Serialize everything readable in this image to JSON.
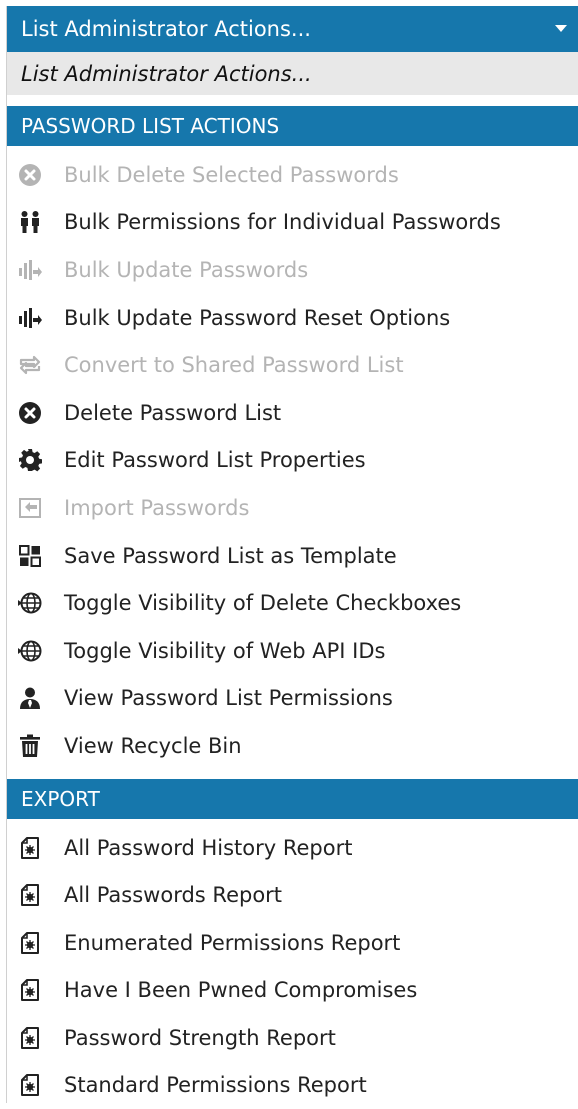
{
  "dropdown": {
    "selected_label": "List Administrator Actions...",
    "selected_option": "List Administrator Actions...",
    "groups": [
      {
        "header": "PASSWORD LIST ACTIONS",
        "items": [
          {
            "label": "Bulk Delete Selected Passwords",
            "icon": "delete-circle-icon",
            "disabled": true
          },
          {
            "label": "Bulk Permissions for Individual Passwords",
            "icon": "users-icon",
            "disabled": false
          },
          {
            "label": "Bulk Update Passwords",
            "icon": "bulk-update-icon",
            "disabled": true
          },
          {
            "label": "Bulk Update Password Reset Options",
            "icon": "bulk-update-icon",
            "disabled": false
          },
          {
            "label": "Convert to Shared Password List",
            "icon": "convert-icon",
            "disabled": true
          },
          {
            "label": "Delete Password List",
            "icon": "delete-circle-icon",
            "disabled": false
          },
          {
            "label": "Edit Password List Properties",
            "icon": "gear-icon",
            "disabled": false
          },
          {
            "label": "Import Passwords",
            "icon": "import-icon",
            "disabled": true
          },
          {
            "label": "Save Password List as Template",
            "icon": "template-grid-icon",
            "disabled": false
          },
          {
            "label": "Toggle Visibility of Delete Checkboxes",
            "icon": "globe-icon",
            "disabled": false
          },
          {
            "label": "Toggle Visibility of Web API IDs",
            "icon": "globe-icon",
            "disabled": false
          },
          {
            "label": "View Password List Permissions",
            "icon": "user-icon",
            "disabled": false
          },
          {
            "label": "View Recycle Bin",
            "icon": "trash-icon",
            "disabled": false
          }
        ]
      },
      {
        "header": "EXPORT",
        "items": [
          {
            "label": "All Password History Report",
            "icon": "report-file-icon",
            "disabled": false
          },
          {
            "label": "All Passwords Report",
            "icon": "report-file-icon",
            "disabled": false
          },
          {
            "label": "Enumerated Permissions Report",
            "icon": "report-file-icon",
            "disabled": false
          },
          {
            "label": "Have I Been Pwned Compromises",
            "icon": "report-file-icon",
            "disabled": false
          },
          {
            "label": "Password Strength Report",
            "icon": "report-file-icon",
            "disabled": false
          },
          {
            "label": "Standard Permissions Report",
            "icon": "report-file-icon",
            "disabled": false
          }
        ]
      }
    ]
  },
  "colors": {
    "accent": "#1677ac",
    "selected_bg": "#e8e8e8",
    "text": "#222222",
    "disabled_text": "#b4b4b4"
  }
}
